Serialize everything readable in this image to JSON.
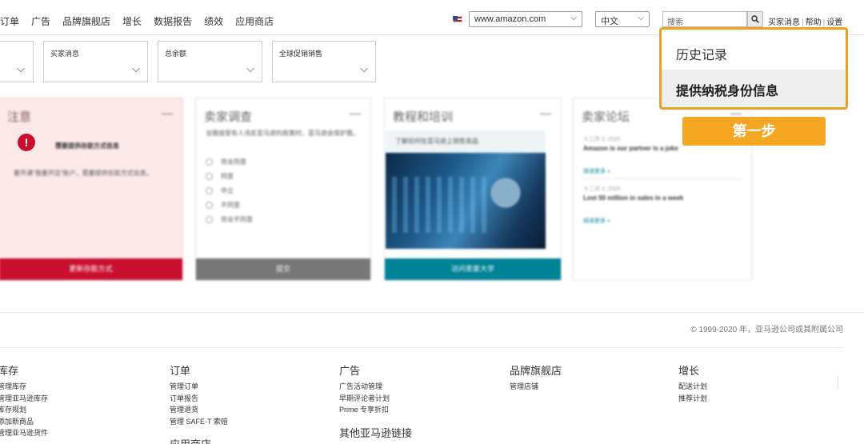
{
  "nav": {
    "links": [
      "订单",
      "广告",
      "品牌旗舰店",
      "增长",
      "数据报告",
      "绩效",
      "应用商店"
    ]
  },
  "header": {
    "marketplace": "www.amazon.com",
    "language": "中文",
    "search_placeholder": "搜索",
    "links": [
      "买家消息",
      "帮助",
      "设置"
    ]
  },
  "filters": [
    "",
    "买家消息",
    "总余额",
    "全球促销销售"
  ],
  "cards": {
    "alert": {
      "title": "注意",
      "headline": "需要提供存款方式信息",
      "body": "要开通\"我要开店\"账户，需要提供存款方式信息。",
      "button": "更新存款方式"
    },
    "survey": {
      "title": "卖家调查",
      "question": "当我接受有人违反亚马逊的政策时，亚马逊会保护我。",
      "options": [
        "完全同意",
        "同意",
        "中立",
        "不同意",
        "完全不同意"
      ],
      "button": "提交"
    },
    "training": {
      "title": "教程和培训",
      "subtitle": "了解如何在亚马逊上销售商品",
      "button": "访问卖家大学"
    },
    "forum": {
      "title": "卖家论坛",
      "posts": [
        {
          "date": "十二月 2, 2020",
          "title": "Amazon is our partner is a joke",
          "more": "阅读更多 »"
        },
        {
          "date": "十二月 2, 2020",
          "title": "Lost 50 million in sales in a week",
          "more": "阅读更多 »"
        }
      ]
    }
  },
  "popup": {
    "item1": "历史记录",
    "item2": "提供纳税身份信息"
  },
  "step_badge": "第一步",
  "footer": {
    "copyright": "© 1999-2020 年，亚马逊公司或其附属公司",
    "columns": [
      {
        "heading": "库存",
        "links": [
          "管理库存",
          "管理亚马逊库存",
          "库存规划",
          "添加新商品",
          "管理亚马逊货件"
        ]
      },
      {
        "heading": "订单",
        "links": [
          "管理订单",
          "订单报告",
          "管理退货",
          "管理 SAFE-T 索赔"
        ]
      },
      {
        "heading": "广告",
        "links": [
          "广告活动管理",
          "早期评论者计划",
          "Prime 专享折扣"
        ]
      },
      {
        "heading": "品牌旗舰店",
        "links": [
          "管理店铺"
        ]
      },
      {
        "heading": "增长",
        "links": [
          "配送计划",
          "推荐计划"
        ]
      }
    ],
    "other_heading": "其他亚马逊链接",
    "app_heading": "应用商店"
  },
  "colors": {
    "accent_orange": "#f5a623",
    "alert_red": "#c8102e",
    "survey_gray": "#777777",
    "training_teal": "#008296"
  }
}
